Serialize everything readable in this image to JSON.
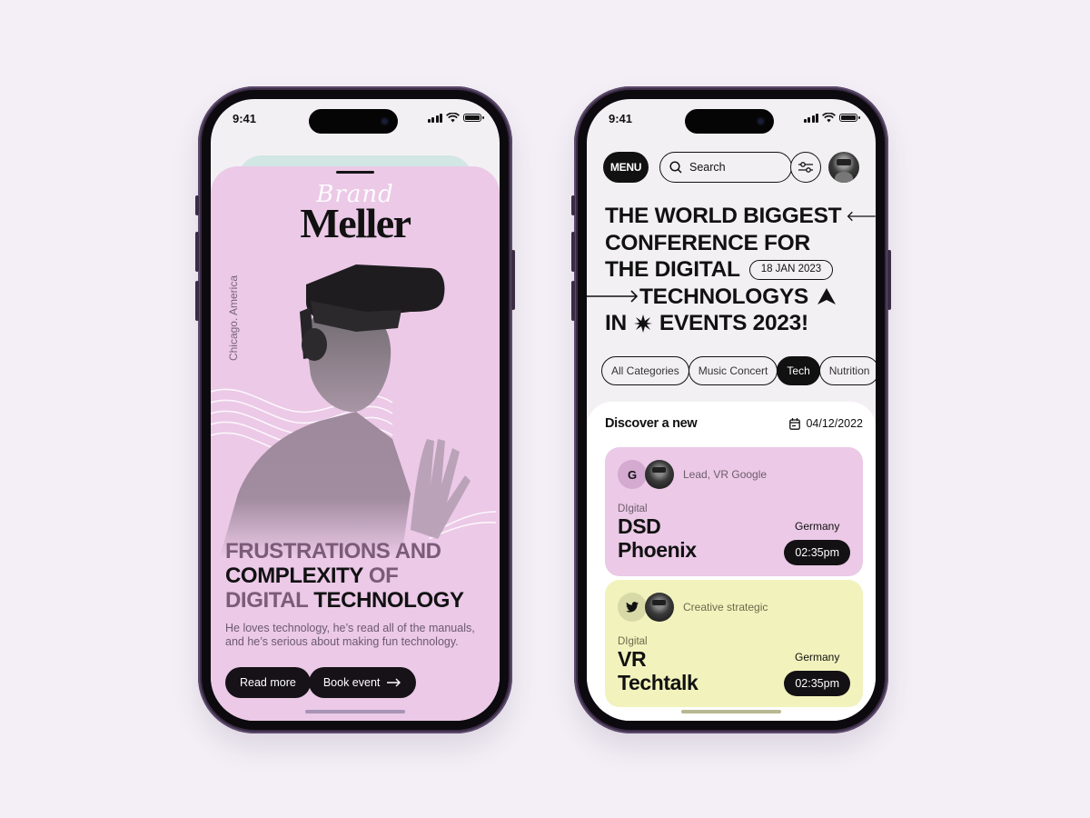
{
  "status_bar": {
    "time": "9:41"
  },
  "left_screen": {
    "brand_script": "Brand",
    "brand_name": "Meller",
    "location": "Chicago. America",
    "headline": {
      "line1_muted": "FRUSTRATIONS AND",
      "line2_dark": "COMPLEXITY",
      "line2_muted": "OF",
      "line3_muted": "DIGITAL",
      "line3_dark": "TECHNOLOGY"
    },
    "description": "He loves technology, he’s read all of the manuals, and he’s serious about making  fun technology.",
    "buttons": {
      "read_more": "Read more",
      "book_event": "Book event"
    }
  },
  "right_screen": {
    "menu_label": "MENU",
    "search_placeholder": "Search",
    "hero": {
      "line1": "THE WORLD BIGGEST",
      "line2": "CONFERENCE FOR",
      "line3": "THE DIGITAL",
      "date_badge": "18 JAN 2023",
      "line4": "TECHNOLOGYS",
      "line5a": "IN",
      "line5b": "EVENTS 2023!"
    },
    "categories": [
      {
        "label": "All Categories",
        "active": false
      },
      {
        "label": "Music Concert",
        "active": false
      },
      {
        "label": "Tech",
        "active": true
      },
      {
        "label": "Nutrition",
        "active": false
      }
    ],
    "discover": {
      "title": "Discover a new",
      "date": "04/12/2022",
      "events": [
        {
          "logo": "G",
          "logo_icon": "google-letter",
          "role": "Lead, VR Google",
          "category": "DIgital",
          "name_line1": "DSD",
          "name_line2": "Phoenix",
          "country": "Germany",
          "time": "02:35pm",
          "color": "#ebc9e7"
        },
        {
          "logo": "",
          "logo_icon": "twitter-bird-icon",
          "role": "Creative strategic",
          "category": "DIgital",
          "name_line1": "VR",
          "name_line2": "Techtalk",
          "country": "Germany",
          "time": "02:35pm",
          "color": "#f2f2bd"
        }
      ]
    }
  }
}
